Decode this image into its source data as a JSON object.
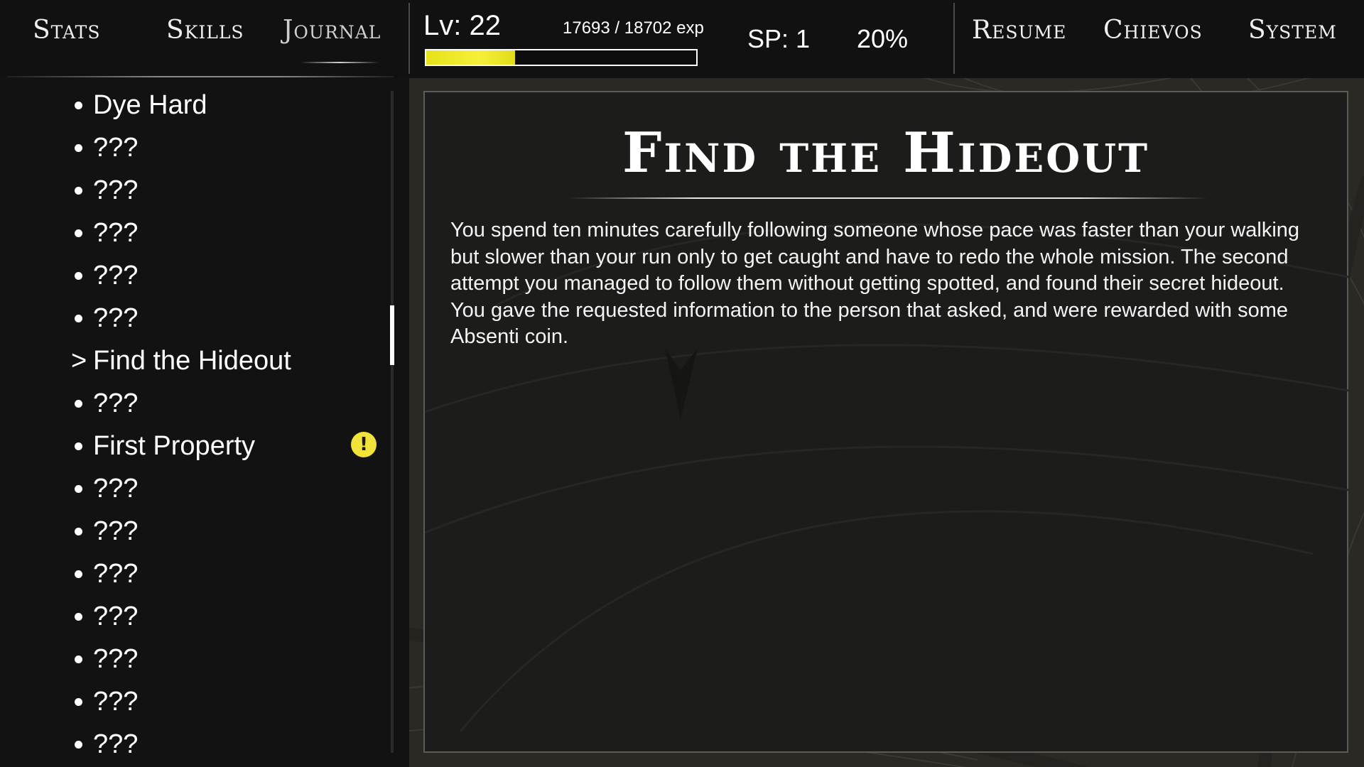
{
  "nav": {
    "tabs": [
      "Stats",
      "Skills",
      "Journal"
    ],
    "active_tab": "Journal",
    "right_menu": [
      "Resume",
      "Chievos",
      "System"
    ]
  },
  "player": {
    "level_label": "Lv: 22",
    "exp_label": "17693 / 18702 exp",
    "exp_bar_fill_fraction": 0.33,
    "exp_bar_color": "#f0ea2c",
    "sp_label": "SP: 1",
    "completion_label": "20%"
  },
  "journal": {
    "selected_marker": ">",
    "quests": [
      {
        "title": "Dye Hard",
        "selected": false,
        "alert": false
      },
      {
        "title": "???",
        "selected": false,
        "alert": false
      },
      {
        "title": "???",
        "selected": false,
        "alert": false
      },
      {
        "title": "???",
        "selected": false,
        "alert": false
      },
      {
        "title": "???",
        "selected": false,
        "alert": false
      },
      {
        "title": "???",
        "selected": false,
        "alert": false
      },
      {
        "title": "Find the Hideout",
        "selected": true,
        "alert": false
      },
      {
        "title": "???",
        "selected": false,
        "alert": false
      },
      {
        "title": "First Property",
        "selected": false,
        "alert": true
      },
      {
        "title": "???",
        "selected": false,
        "alert": false
      },
      {
        "title": "???",
        "selected": false,
        "alert": false
      },
      {
        "title": "???",
        "selected": false,
        "alert": false
      },
      {
        "title": "???",
        "selected": false,
        "alert": false
      },
      {
        "title": "???",
        "selected": false,
        "alert": false
      },
      {
        "title": "???",
        "selected": false,
        "alert": false
      },
      {
        "title": "???",
        "selected": false,
        "alert": false
      }
    ],
    "alert_icon": "exclamation-icon",
    "alert_color": "#f2e33a",
    "alert_symbol": "!"
  },
  "entry": {
    "title": "Find the Hideout",
    "description": "You spend ten minutes carefully following someone whose pace was faster than your walking but slower than your run only to get caught and have to redo the whole mission. The second attempt you managed to follow them without getting spotted, and found their secret hideout. You gave the requested information to the person that asked, and were rewarded with some Absenti coin."
  }
}
